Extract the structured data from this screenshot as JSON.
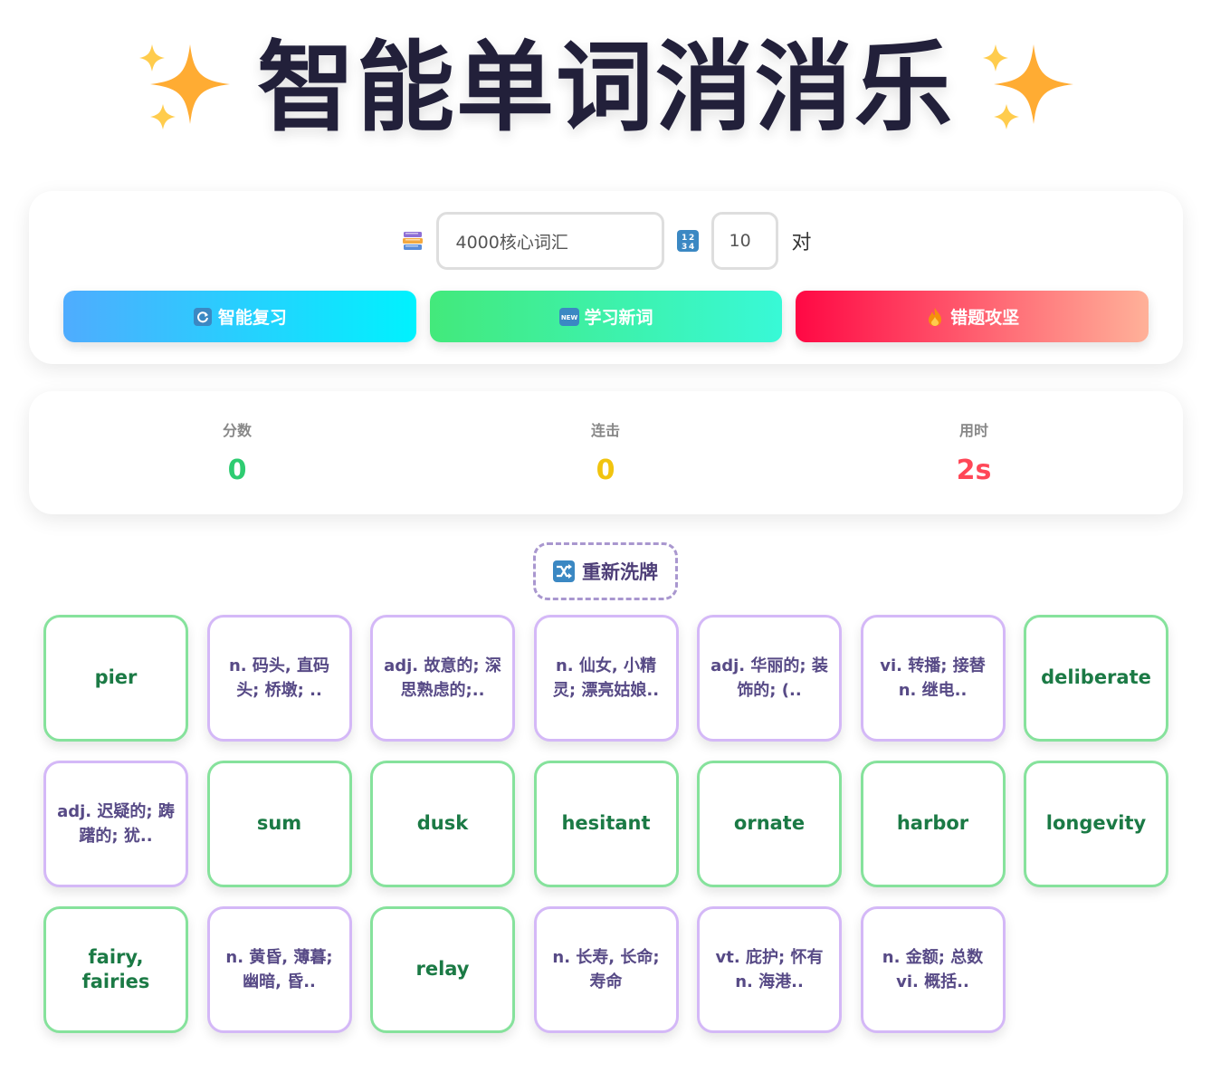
{
  "header": {
    "title": "智能单词消消乐",
    "left_icon": "sparkles-icon",
    "right_icon": "sparkles-icon"
  },
  "controls": {
    "vocab_icon": "books-icon",
    "vocab_value": "4000核心词汇",
    "count_icon": "numbers-icon",
    "count_value": "10",
    "count_unit": "对",
    "buttons": [
      {
        "icon": "refresh-icon",
        "label": "智能复习"
      },
      {
        "icon": "new-icon",
        "label": "学习新词"
      },
      {
        "icon": "fire-icon",
        "label": "错题攻坚"
      }
    ]
  },
  "stats": {
    "score": {
      "label": "分数",
      "value": "0",
      "color": "#2ecc71"
    },
    "combo": {
      "label": "连击",
      "value": "0",
      "color": "#f1c40f"
    },
    "time": {
      "label": "用时",
      "value": "2s",
      "color": "#ff4757"
    }
  },
  "shuffle": {
    "icon": "shuffle-icon",
    "label": "重新洗牌"
  },
  "cards": [
    {
      "type": "word",
      "text": "pier"
    },
    {
      "type": "meaning",
      "text": "n. 码头, 直码头; 桥墩; .."
    },
    {
      "type": "meaning",
      "text": "adj. 故意的; 深思熟虑的;.."
    },
    {
      "type": "meaning",
      "text": "n. 仙女, 小精灵; 漂亮姑娘.."
    },
    {
      "type": "meaning",
      "text": "adj. 华丽的; 装饰的; (.."
    },
    {
      "type": "meaning",
      "text": "vi. 转播; 接替 n. 继电.."
    },
    {
      "type": "word",
      "text": "deliberate"
    },
    {
      "type": "meaning",
      "text": "adj. 迟疑的; 踌躇的; 犹.."
    },
    {
      "type": "word",
      "text": "sum"
    },
    {
      "type": "word",
      "text": "dusk"
    },
    {
      "type": "word",
      "text": "hesitant"
    },
    {
      "type": "word",
      "text": "ornate"
    },
    {
      "type": "word",
      "text": "harbor"
    },
    {
      "type": "word",
      "text": "longevity"
    },
    {
      "type": "word",
      "text": "fairy, fairies"
    },
    {
      "type": "meaning",
      "text": "n. 黄昏, 薄暮; 幽暗, 昏.."
    },
    {
      "type": "word",
      "text": "relay"
    },
    {
      "type": "meaning",
      "text": "n. 长寿, 长命; 寿命"
    },
    {
      "type": "meaning",
      "text": "vt. 庇护; 怀有 n. 海港.."
    },
    {
      "type": "meaning",
      "text": "n. 金额; 总数 vi. 概括.."
    }
  ]
}
